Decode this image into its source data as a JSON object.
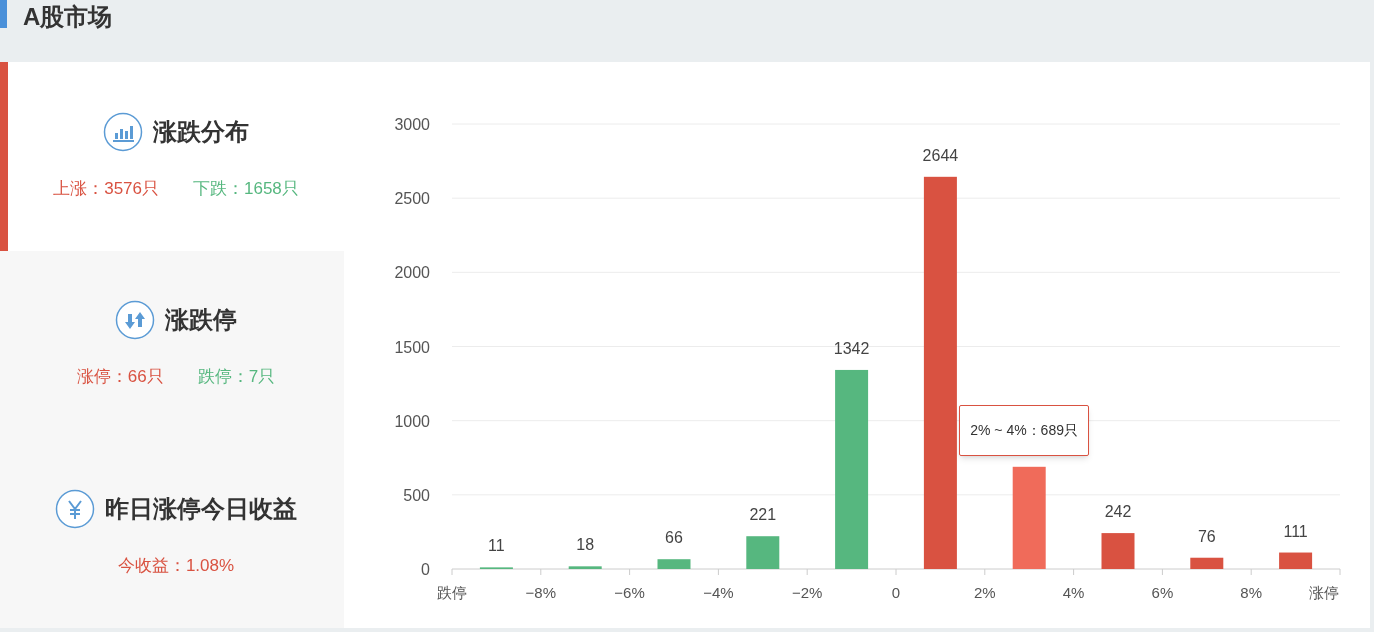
{
  "header": {
    "title": "A股市场"
  },
  "sidebar": {
    "items": [
      {
        "title": "涨跌分布",
        "selected": true,
        "stats": [
          {
            "text": "上涨：3576只",
            "kind": "up"
          },
          {
            "text": "下跌：1658只",
            "kind": "down"
          }
        ]
      },
      {
        "title": "涨跌停",
        "selected": false,
        "stats": [
          {
            "text": "涨停：66只",
            "kind": "up"
          },
          {
            "text": "跌停：7只",
            "kind": "down"
          }
        ]
      },
      {
        "title": "昨日涨停今日收益",
        "selected": false,
        "stats": [
          {
            "text": "今收益：1.08%",
            "kind": "up"
          }
        ]
      }
    ]
  },
  "chart_data": {
    "type": "bar",
    "x": [
      -9,
      -7,
      -5,
      -3,
      -1,
      1,
      3,
      5,
      7,
      9
    ],
    "series": [
      {
        "color": "#56b77f",
        "values": [
          11,
          18,
          66,
          221,
          1342,
          null,
          null,
          null,
          null,
          null
        ]
      },
      {
        "color": "#d95241",
        "values": [
          null,
          null,
          null,
          null,
          null,
          2644,
          null,
          242,
          76,
          111
        ]
      },
      {
        "color": "#f06b5a",
        "values": [
          null,
          null,
          null,
          null,
          null,
          null,
          689,
          null,
          null,
          null
        ]
      }
    ],
    "xlim": [
      -10,
      10
    ],
    "ylim": [
      0,
      3000
    ],
    "xticks": [
      {
        "value": -10,
        "label": "跌停"
      },
      {
        "value": -8,
        "label": "−8%"
      },
      {
        "value": -6,
        "label": "−6%"
      },
      {
        "value": -4,
        "label": "−4%"
      },
      {
        "value": -2,
        "label": "−2%"
      },
      {
        "value": 0,
        "label": "0"
      },
      {
        "value": 2,
        "label": "2%"
      },
      {
        "value": 4,
        "label": "4%"
      },
      {
        "value": 6,
        "label": "6%"
      },
      {
        "value": 8,
        "label": "8%"
      },
      {
        "value": 10,
        "label": "涨停"
      }
    ],
    "yticks": [
      0,
      500,
      1000,
      1500,
      2000,
      2500,
      3000
    ],
    "value_labels": [
      "11",
      "18",
      "66",
      "221",
      "1342",
      "2644",
      null,
      "242",
      "76",
      "111"
    ],
    "grid": true,
    "annotations": [
      {
        "x": 3,
        "y": 689,
        "text": "2% ~ 4%：689只"
      }
    ]
  }
}
